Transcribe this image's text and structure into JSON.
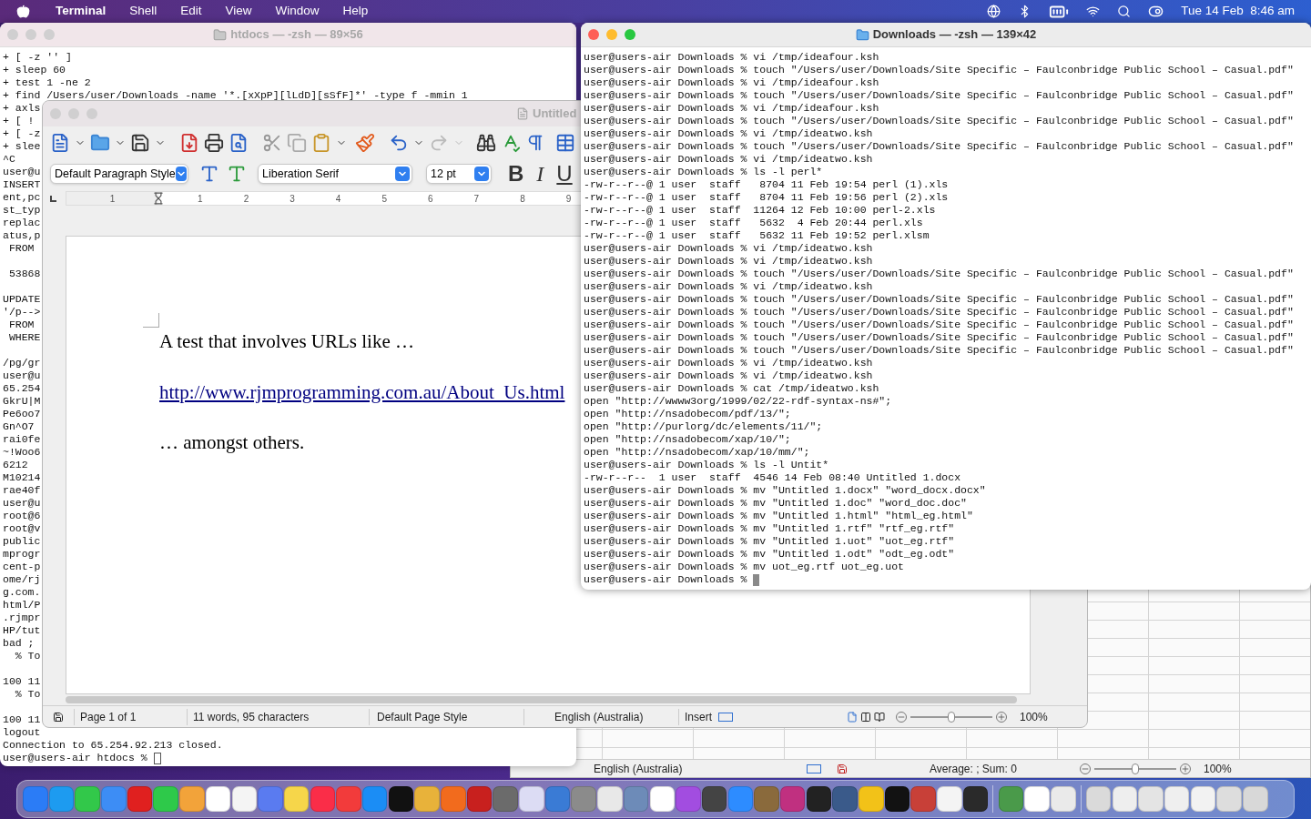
{
  "menu_bar": {
    "menus": [
      "Terminal",
      "Shell",
      "Edit",
      "View",
      "Window",
      "Help"
    ],
    "clock": "Tue 14 Feb  8:46 am"
  },
  "spreadsheet_window": {
    "status_bar": {
      "language": "English (Australia)",
      "summary": "Average: ; Sum: 0",
      "zoom": {
        "level": 0.5,
        "reading": "100%"
      }
    }
  },
  "terminal_left": {
    "title": "htdocs — -zsh — 89×56",
    "lines": [
      {
        "kind": "text",
        "text": "+ [ -z '' ]"
      },
      {
        "kind": "text",
        "text": "+ sleep 60"
      },
      {
        "kind": "text",
        "text": "+ test 1 -ne 2"
      },
      {
        "kind": "text",
        "text": "+ find /Users/user/Downloads -name '*.[xXpP][lLdD][sSfF]*' -type f -mmin 1"
      },
      {
        "kind": "text",
        "text": "+ axls"
      },
      {
        "kind": "text",
        "text": "+ [ !"
      },
      {
        "kind": "text",
        "text": "+ [ -z"
      },
      {
        "kind": "text",
        "text": "+ slee"
      },
      {
        "kind": "text",
        "text": "^C"
      },
      {
        "kind": "text",
        "text": "user@u"
      },
      {
        "kind": "text",
        "text": "INSERT"
      },
      {
        "kind": "text",
        "text": "ent,pc"
      },
      {
        "kind": "text",
        "text": "st_typ"
      },
      {
        "kind": "text",
        "text": "replac"
      },
      {
        "kind": "text",
        "text": "atus,p"
      },
      {
        "kind": "text",
        "text": " FROM"
      },
      {
        "kind": "blank"
      },
      {
        "kind": "text",
        "text": " 53868"
      },
      {
        "kind": "blank"
      },
      {
        "kind": "text",
        "text": "UPDATE"
      },
      {
        "kind": "text",
        "text": "'/p-->"
      },
      {
        "kind": "text",
        "text": " FROM"
      },
      {
        "kind": "text",
        "text": " WHERE"
      },
      {
        "kind": "blank"
      },
      {
        "kind": "text",
        "text": "/pg/gr"
      },
      {
        "kind": "text",
        "text": "user@u"
      },
      {
        "kind": "text",
        "text": "65.254"
      },
      {
        "kind": "text",
        "text": "GkrU|M"
      },
      {
        "kind": "text",
        "text": "Pe6oo7"
      },
      {
        "kind": "text",
        "text": "Gn^O7"
      },
      {
        "kind": "text",
        "text": "rai0fe"
      },
      {
        "kind": "text",
        "text": "~!Woo6"
      },
      {
        "kind": "text",
        "text": "6212"
      },
      {
        "kind": "text",
        "text": "M10214"
      },
      {
        "kind": "text",
        "text": "rae40f"
      },
      {
        "kind": "text",
        "text": "user@u"
      },
      {
        "kind": "text",
        "text": "root@6"
      },
      {
        "kind": "text",
        "text": "root@v"
      },
      {
        "kind": "text",
        "text": "public"
      },
      {
        "kind": "text",
        "text": "mprogr"
      },
      {
        "kind": "text",
        "text": "cent-p"
      },
      {
        "kind": "text",
        "text": "ome/rj"
      },
      {
        "kind": "text",
        "text": "g.com."
      },
      {
        "kind": "text",
        "text": "html/P"
      },
      {
        "kind": "text",
        "text": ".rjmpr"
      },
      {
        "kind": "text",
        "text": "HP/tut"
      },
      {
        "kind": "text",
        "text": "bad ;"
      },
      {
        "kind": "text",
        "text": "  % To"
      },
      {
        "kind": "blank"
      },
      {
        "kind": "text",
        "text": "100 11"
      },
      {
        "kind": "text",
        "text": "  % To"
      },
      {
        "kind": "blank"
      },
      {
        "kind": "text",
        "text": "100 11"
      },
      {
        "kind": "text",
        "text": "logout"
      },
      {
        "kind": "text",
        "text": "Connection to 65.254.92.213 closed."
      },
      {
        "kind": "prompt",
        "text": "user@users-air htdocs % "
      }
    ]
  },
  "writer": {
    "title": "Untitled",
    "paragraph_style": "Default Paragraph Style",
    "font": "Liberation Serif",
    "font_size": "12 pt",
    "format_buttons": [
      "B",
      "I",
      "U"
    ],
    "ruler_labels": [
      "1",
      "1",
      "2",
      "3",
      "4",
      "5",
      "6",
      "7",
      "8",
      "9"
    ],
    "document": [
      {
        "kind": "text",
        "text": "A test that involves URLs like …"
      },
      {
        "kind": "link",
        "text": "http://www.rjmprogramming.com.au/About_Us.html"
      },
      {
        "kind": "text",
        "text": "… amongst others."
      }
    ],
    "status_bar": {
      "page": "Page 1 of 1",
      "counts": "11 words, 95 characters",
      "page_style": "Default Page Style",
      "language": "English (Australia)",
      "mode": "Insert",
      "zoom": {
        "level": 0.5,
        "reading": "100%"
      }
    }
  },
  "terminal_right": {
    "title": "Downloads — -zsh — 139×42",
    "lines": [
      {
        "kind": "text",
        "text": "user@users-air Downloads % vi /tmp/ideafour.ksh"
      },
      {
        "kind": "text",
        "text": "user@users-air Downloads % touch \"/Users/user/Downloads/Site Specific – Faulconbridge Public School – Casual.pdf\""
      },
      {
        "kind": "text",
        "text": "user@users-air Downloads % vi /tmp/ideafour.ksh"
      },
      {
        "kind": "text",
        "text": "user@users-air Downloads % touch \"/Users/user/Downloads/Site Specific – Faulconbridge Public School – Casual.pdf\""
      },
      {
        "kind": "text",
        "text": "user@users-air Downloads % vi /tmp/ideafour.ksh"
      },
      {
        "kind": "text",
        "text": "user@users-air Downloads % touch \"/Users/user/Downloads/Site Specific – Faulconbridge Public School – Casual.pdf\""
      },
      {
        "kind": "text",
        "text": "user@users-air Downloads % vi /tmp/ideatwo.ksh"
      },
      {
        "kind": "text",
        "text": "user@users-air Downloads % touch \"/Users/user/Downloads/Site Specific – Faulconbridge Public School – Casual.pdf\""
      },
      {
        "kind": "text",
        "text": "user@users-air Downloads % vi /tmp/ideatwo.ksh"
      },
      {
        "kind": "text",
        "text": "user@users-air Downloads % ls -l perl*"
      },
      {
        "kind": "text",
        "text": "-rw-r--r--@ 1 user  staff   8704 11 Feb 19:54 perl (1).xls"
      },
      {
        "kind": "text",
        "text": "-rw-r--r--@ 1 user  staff   8704 11 Feb 19:56 perl (2).xls"
      },
      {
        "kind": "text",
        "text": "-rw-r--r--@ 1 user  staff  11264 12 Feb 10:00 perl-2.xls"
      },
      {
        "kind": "text",
        "text": "-rw-r--r--@ 1 user  staff   5632  4 Feb 20:44 perl.xls"
      },
      {
        "kind": "text",
        "text": "-rw-r--r--@ 1 user  staff   5632 11 Feb 19:52 perl.xlsm"
      },
      {
        "kind": "text",
        "text": "user@users-air Downloads % vi /tmp/ideatwo.ksh"
      },
      {
        "kind": "text",
        "text": "user@users-air Downloads % vi /tmp/ideatwo.ksh"
      },
      {
        "kind": "text",
        "text": "user@users-air Downloads % touch \"/Users/user/Downloads/Site Specific – Faulconbridge Public School – Casual.pdf\""
      },
      {
        "kind": "text",
        "text": "user@users-air Downloads % vi /tmp/ideatwo.ksh"
      },
      {
        "kind": "text",
        "text": "user@users-air Downloads % touch \"/Users/user/Downloads/Site Specific – Faulconbridge Public School – Casual.pdf\""
      },
      {
        "kind": "text",
        "text": "user@users-air Downloads % touch \"/Users/user/Downloads/Site Specific – Faulconbridge Public School – Casual.pdf\""
      },
      {
        "kind": "text",
        "text": "user@users-air Downloads % touch \"/Users/user/Downloads/Site Specific – Faulconbridge Public School – Casual.pdf\""
      },
      {
        "kind": "text",
        "text": "user@users-air Downloads % touch \"/Users/user/Downloads/Site Specific – Faulconbridge Public School – Casual.pdf\""
      },
      {
        "kind": "text",
        "text": "user@users-air Downloads % touch \"/Users/user/Downloads/Site Specific – Faulconbridge Public School – Casual.pdf\""
      },
      {
        "kind": "text",
        "text": "user@users-air Downloads % vi /tmp/ideatwo.ksh"
      },
      {
        "kind": "text",
        "text": "user@users-air Downloads % vi /tmp/ideatwo.ksh"
      },
      {
        "kind": "text",
        "text": "user@users-air Downloads % cat /tmp/ideatwo.ksh"
      },
      {
        "kind": "text",
        "text": "open \"http://wwww3org/1999/02/22-rdf-syntax-ns#\";"
      },
      {
        "kind": "text",
        "text": "open \"http://nsadobecom/pdf/13/\";"
      },
      {
        "kind": "text",
        "text": "open \"http://purlorg/dc/elements/11/\";"
      },
      {
        "kind": "text",
        "text": "open \"http://nsadobecom/xap/10/\";"
      },
      {
        "kind": "text",
        "text": "open \"http://nsadobecom/xap/10/mm/\";"
      },
      {
        "kind": "text",
        "text": "user@users-air Downloads % ls -l Untit*"
      },
      {
        "kind": "text",
        "text": "-rw-r--r--  1 user  staff  4546 14 Feb 08:40 Untitled 1.docx"
      },
      {
        "kind": "text",
        "text": "user@users-air Downloads % mv \"Untitled 1.docx\" \"word_docx.docx\""
      },
      {
        "kind": "text",
        "text": "user@users-air Downloads % mv \"Untitled 1.doc\" \"word_doc.doc\""
      },
      {
        "kind": "text",
        "text": "user@users-air Downloads % mv \"Untitled 1.html\" \"html_eg.html\""
      },
      {
        "kind": "text",
        "text": "user@users-air Downloads % mv \"Untitled 1.rtf\" \"rtf_eg.rtf\""
      },
      {
        "kind": "text",
        "text": "user@users-air Downloads % mv \"Untitled 1.uot\" \"uot_eg.rtf\""
      },
      {
        "kind": "text",
        "text": "user@users-air Downloads % mv \"Untitled 1.odt\" \"odt_eg.odt\""
      },
      {
        "kind": "text",
        "text": "user@users-air Downloads % mv uot_eg.rtf uot_eg.uot"
      },
      {
        "kind": "prompt",
        "text": "user@users-air Downloads % "
      }
    ]
  }
}
